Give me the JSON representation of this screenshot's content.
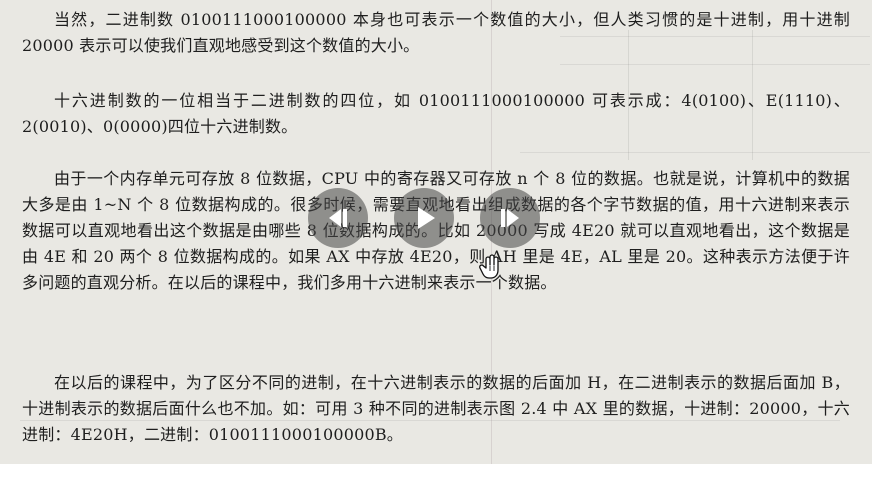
{
  "document": {
    "paragraphs": [
      "当然，二进制数 0100111000100000 本身也可表示一个数值的大小，但人类习惯的是十进制，用十进制 20000 表示可以使我们直观地感受到这个数值的大小。",
      "十六进制数的一位相当于二进制数的四位，如 0100111000100000 可表示成：4(0100)、E(1110)、2(0010)、0(0000)四位十六进制数。",
      "由于一个内存单元可存放 8 位数据，CPU 中的寄存器又可存放 n 个 8 位的数据。也就是说，计算机中的数据大多是由 1~N 个 8 位数据构成的。很多时候，需要直观地看出组成数据的各个字节数据的值，用十六进制来表示数据可以直观地看出这个数据是由哪些 8 位数据构成的。比如 20000 写成 4E20 就可以直观地看出，这个数据是由 4E 和 20 两个 8 位数据构成的。如果 AX 中存放 4E20，则 AH 里是 4E，AL 里是 20。这种表示方法便于许多问题的直观分析。在以后的课程中，我们多用十六进制来表示一个数据。",
      "在以后的课程中，为了区分不同的进制，在十六进制表示的数据的后面加 H，在二进制表示的数据后面加 B，十进制表示的数据后面什么也不加。如：可用 3 种不同的进制表示图 2.4 中 AX 里的数据，十进制：20000，十六进制：4E20H，二进制：0100111000100000B。"
    ]
  },
  "player": {
    "prev_icon": "skip-back-icon",
    "play_icon": "play-icon",
    "next_icon": "skip-forward-icon"
  },
  "cursor": {
    "icon": "hand-pointer-icon"
  },
  "colors": {
    "page_background": "#e9e8e3",
    "text": "#1e1e1e",
    "control_overlay": "rgba(70,70,70,0.55)",
    "control_glyph": "#ffffff"
  }
}
